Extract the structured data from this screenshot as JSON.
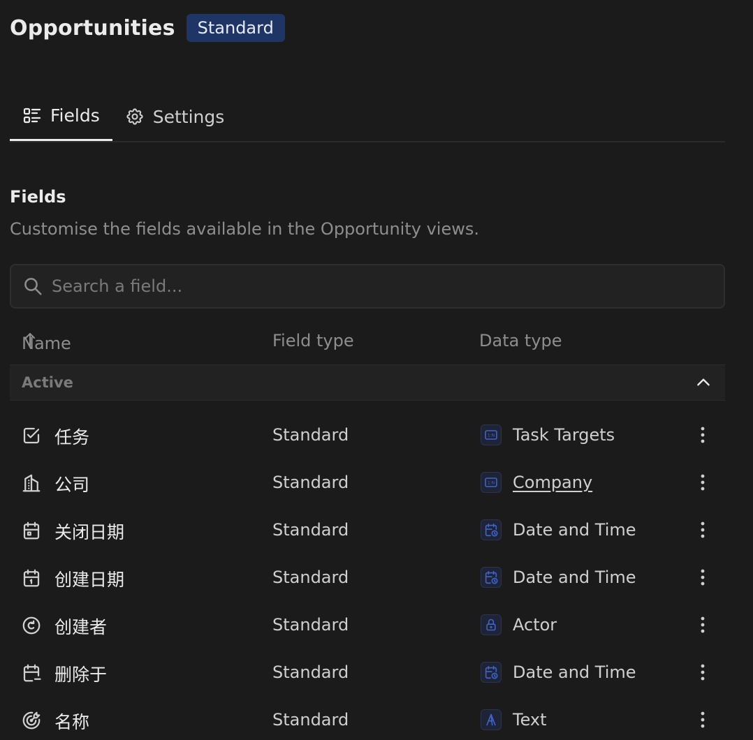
{
  "header": {
    "title": "Opportunities",
    "badge": "Standard"
  },
  "tabs": [
    {
      "label": "Fields",
      "icon": "list-details-icon",
      "active": true
    },
    {
      "label": "Settings",
      "icon": "settings-gear-icon",
      "active": false
    }
  ],
  "section": {
    "title": "Fields",
    "description": "Customise the fields available in the Opportunity views."
  },
  "search": {
    "placeholder": "Search a field...",
    "value": ""
  },
  "columns": {
    "name": "Name",
    "field_type": "Field type",
    "data_type": "Data type",
    "sort_icon": "arrow-up-icon"
  },
  "group": {
    "label": "Active",
    "expanded": true
  },
  "rows": [
    {
      "name": "任务",
      "name_icon": "checkbox-icon",
      "field_type": "Standard",
      "data_type": "Task Targets",
      "data_icon": "relation-icon",
      "link": false
    },
    {
      "name": "公司",
      "name_icon": "building-icon",
      "field_type": "Standard",
      "data_type": "Company",
      "data_icon": "relation-icon",
      "link": true
    },
    {
      "name": "关闭日期",
      "name_icon": "calendar-icon",
      "field_type": "Standard",
      "data_type": "Date and Time",
      "data_icon": "calendar-clock-icon",
      "link": false
    },
    {
      "name": "创建日期",
      "name_icon": "calendar-one-icon",
      "field_type": "Standard",
      "data_type": "Date and Time",
      "data_icon": "calendar-clock-icon",
      "link": false
    },
    {
      "name": "创建者",
      "name_icon": "creation-icon",
      "field_type": "Standard",
      "data_type": "Actor",
      "data_icon": "lock-icon",
      "link": false
    },
    {
      "name": "删除于",
      "name_icon": "calendar-minus-icon",
      "field_type": "Standard",
      "data_type": "Date and Time",
      "data_icon": "calendar-clock-icon",
      "link": false
    },
    {
      "name": "名称",
      "name_icon": "target-arrow-icon",
      "field_type": "Standard",
      "data_type": "Text",
      "data_icon": "text-icon",
      "link": false
    }
  ],
  "colors": {
    "background": "#1b1b1b",
    "badge_bg": "#1f3566",
    "accent_icon": "#3f63c9"
  }
}
